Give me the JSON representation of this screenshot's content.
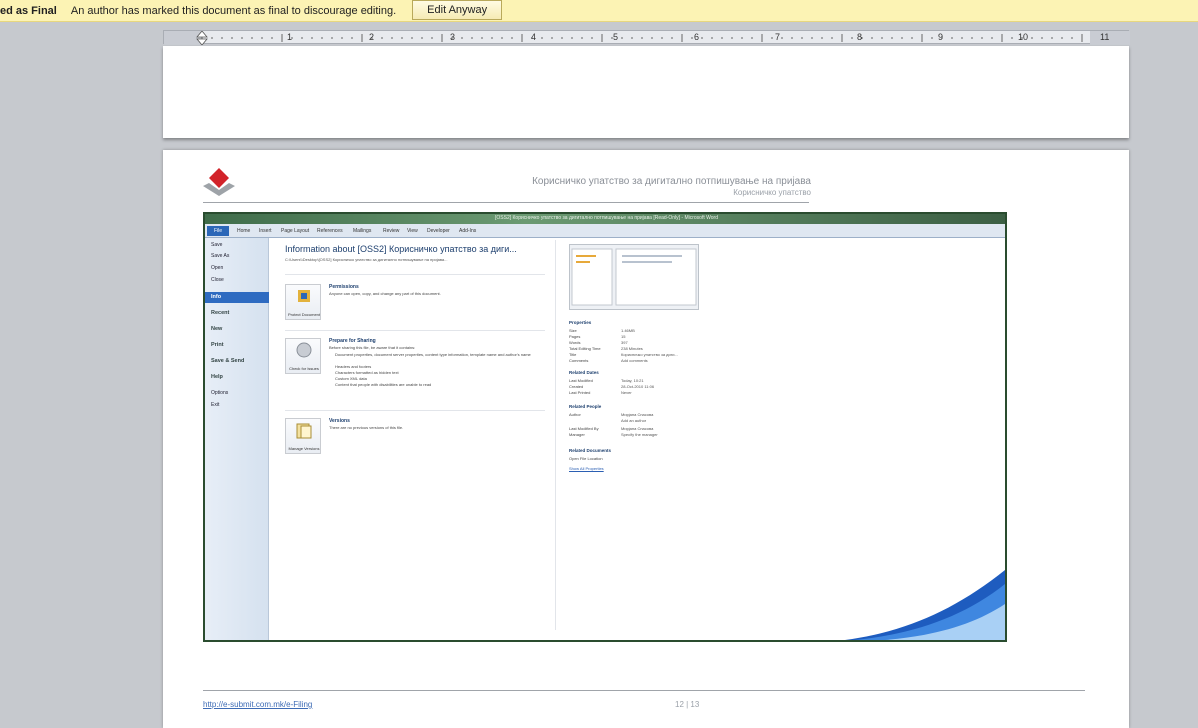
{
  "message_bar": {
    "title": "ed as Final",
    "text": "An author has marked this document as final to discourage editing.",
    "button": "Edit Anyway",
    "bg_color": "#fcf3b4"
  },
  "ruler": {
    "numbers": [
      "1",
      "2",
      "3",
      "4",
      "5",
      "6",
      "7",
      "8",
      "9",
      "10",
      "11"
    ]
  },
  "page_header": {
    "title": "Корисничко упатство за дигитално потпишување на пријава",
    "subtitle": "Корисничко упатство",
    "logo_icon": "diamond-logo-icon"
  },
  "embedded": {
    "title": "[OSS2] Корисничко упатство за дигитално потпишување на пријава [Read-Only] - Microsoft Word",
    "file_tab": "File",
    "tabs": [
      "Home",
      "Insert",
      "Page Layout",
      "References",
      "Mailings",
      "Review",
      "View",
      "Developer",
      "Add-Ins"
    ],
    "left_items_small": [
      "Save",
      "Save As",
      "Open",
      "Close"
    ],
    "selected": "Info",
    "left_items_big": [
      "Recent",
      "New",
      "Print",
      "Save & Send",
      "Help"
    ],
    "left_items_tail": [
      "Options",
      "Exit"
    ],
    "info_title": "Information about [OSS2] Корисничко упатство за диги...",
    "info_path": "C:\\Users\\\\Desktop\\[OSS2] Корисничко упатство за дигитално потпишување на пријава...",
    "sections": [
      {
        "button": "Protect Document",
        "heading": "Permissions",
        "desc": "Anyone can open, copy, and change any part of this document.",
        "bullets": []
      },
      {
        "button": "Check for Issues",
        "heading": "Prepare for Sharing",
        "desc": "Before sharing this file, be aware that it contains:",
        "bullets": [
          "Document properties, document server properties, content type information, template name and author's name",
          "Headers and footers",
          "Characters formatted as hidden text",
          "Custom XML data",
          "Content that people with disabilities are unable to read"
        ]
      },
      {
        "button": "Manage Versions",
        "heading": "Versions",
        "desc": "There are no previous versions of this file.",
        "bullets": []
      }
    ],
    "properties_heading": "Properties",
    "properties": [
      {
        "k": "Size",
        "v": "1.46MB"
      },
      {
        "k": "Pages",
        "v": "15"
      },
      {
        "k": "Words",
        "v": "397"
      },
      {
        "k": "Total Editing Time",
        "v": "238 Minutes"
      },
      {
        "k": "Title",
        "v": "Корисничко упатство за диги..."
      },
      {
        "k": "Comments",
        "v": "Add comments"
      }
    ],
    "dates_heading": "Related Dates",
    "dates": [
      {
        "k": "Last Modified",
        "v": "Today, 10:21"
      },
      {
        "k": "Created",
        "v": "28-Oct-2010 11:06"
      },
      {
        "k": "Last Printed",
        "v": "Never"
      }
    ],
    "people_heading": "Related People",
    "people": [
      {
        "k": "Author",
        "v": "Мирјана Спасова"
      },
      {
        "k": "",
        "v": "Add an author"
      },
      {
        "k": "Last Modified By",
        "v": "Мирјана Спасова"
      },
      {
        "k": "Manager",
        "v": "Specify the manager"
      }
    ],
    "docs_heading": "Related Documents",
    "open_location": "Open File Location",
    "show_all": "Show All Properties"
  },
  "footer": {
    "url": "http://e-submit.com.mk/e-Filing",
    "page": "12 | 13"
  }
}
